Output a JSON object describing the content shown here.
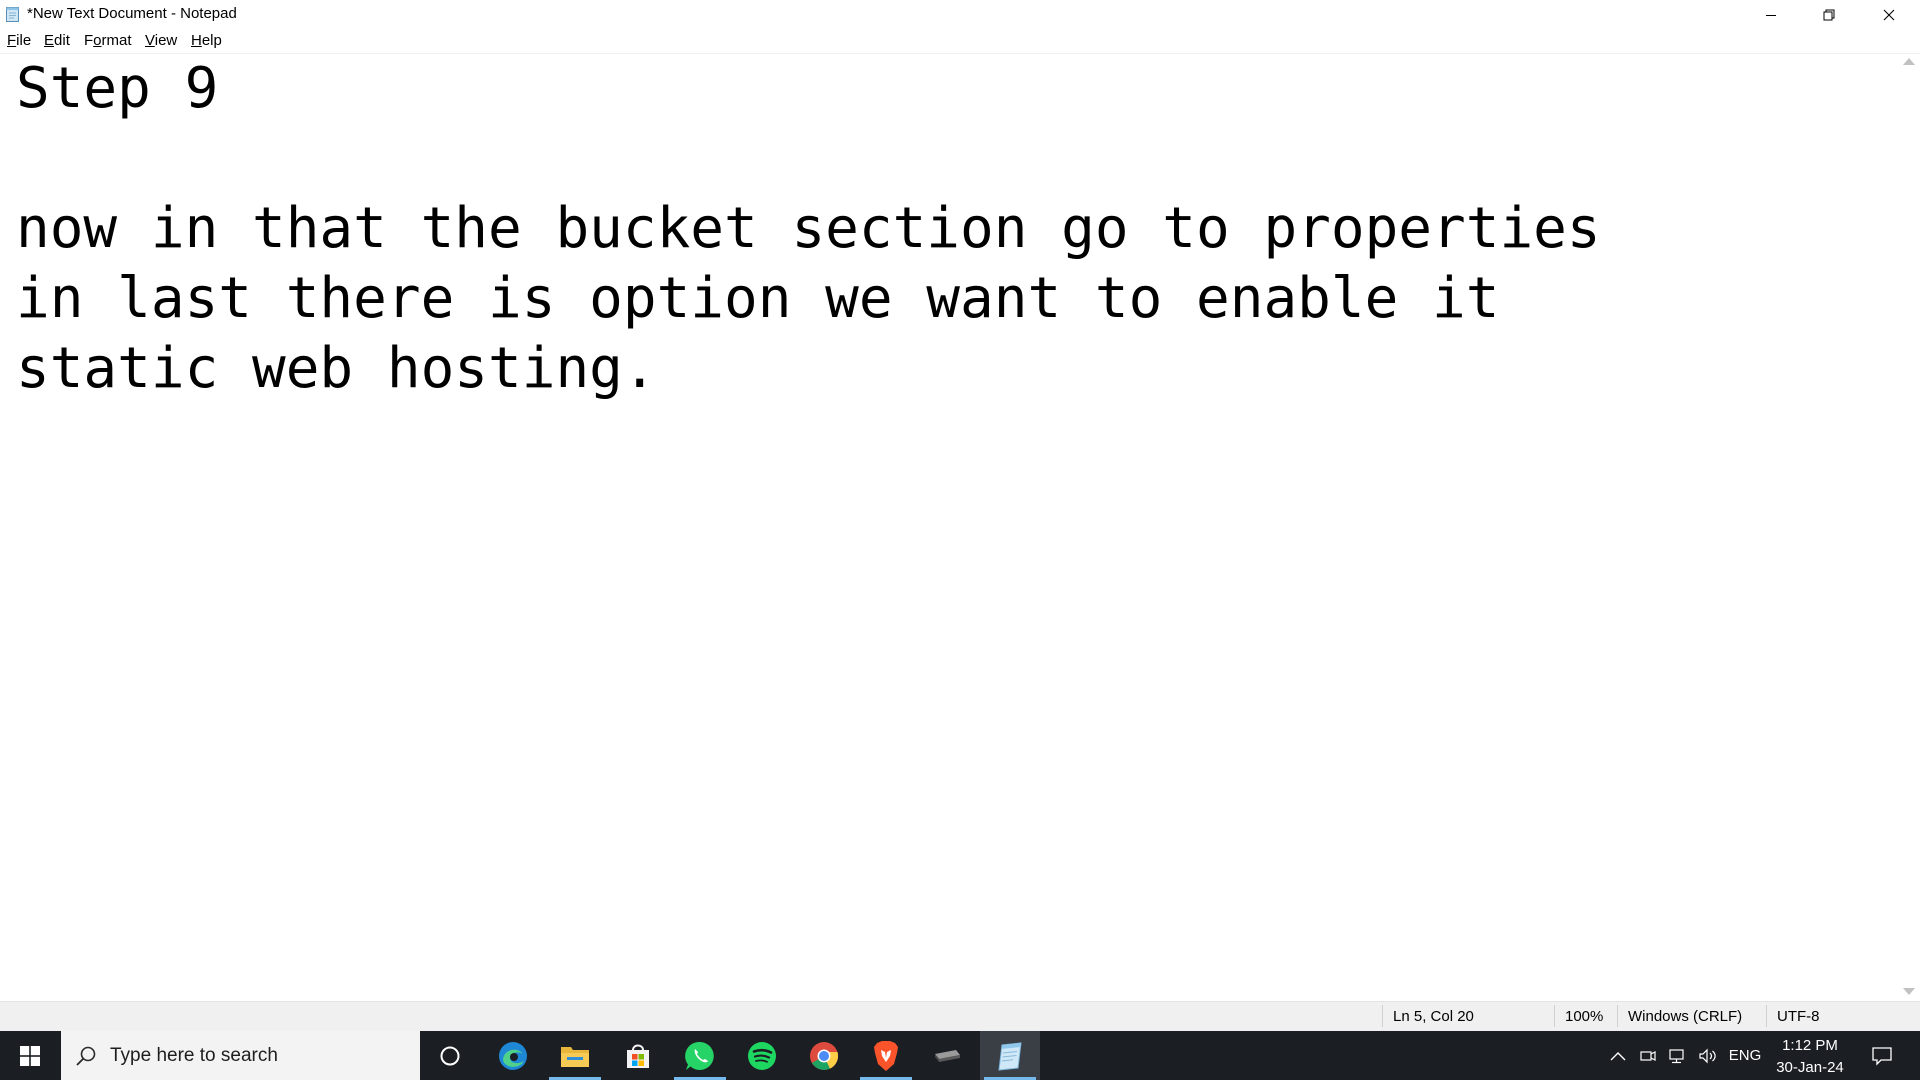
{
  "window": {
    "title": "*New Text Document - Notepad",
    "app_icon": "notepad-icon",
    "controls": {
      "minimize_icon": "minimize-icon",
      "maximize_icon": "restore-icon",
      "close_icon": "close-icon"
    }
  },
  "menu": {
    "items": [
      {
        "label_mnemonic": "F",
        "label_rest": "ile"
      },
      {
        "label_mnemonic": "E",
        "label_rest": "dit"
      },
      {
        "label_prefix": "F",
        "label_mnemonic": "o",
        "label_rest": "rmat"
      },
      {
        "label_mnemonic": "V",
        "label_rest": "iew"
      },
      {
        "label_mnemonic": "H",
        "label_rest": "elp"
      }
    ]
  },
  "editor": {
    "content": "Step 9\n\nnow in that the bucket section go to properties\nin last there is option we want to enable it\nstatic web hosting."
  },
  "status": {
    "position": "Ln 5, Col 20",
    "zoom": "100%",
    "line_ending": "Windows (CRLF)",
    "encoding": "UTF-8"
  },
  "taskbar": {
    "search_placeholder": "Type here to search",
    "apps": [
      {
        "name": "cortana-icon"
      },
      {
        "name": "edge-icon"
      },
      {
        "name": "file-explorer-icon"
      },
      {
        "name": "microsoft-store-icon"
      },
      {
        "name": "whatsapp-icon"
      },
      {
        "name": "spotify-icon"
      },
      {
        "name": "chrome-icon"
      },
      {
        "name": "brave-icon"
      },
      {
        "name": "camera-app-icon"
      },
      {
        "name": "notepad-icon"
      }
    ],
    "tray": {
      "language": "ENG",
      "time": "1:12 PM",
      "date": "30-Jan-24"
    }
  },
  "colors": {
    "taskbar_bg": "#1b1f24",
    "accent_run": "#76b9ed",
    "statusbar_bg": "#f0f0f0"
  }
}
